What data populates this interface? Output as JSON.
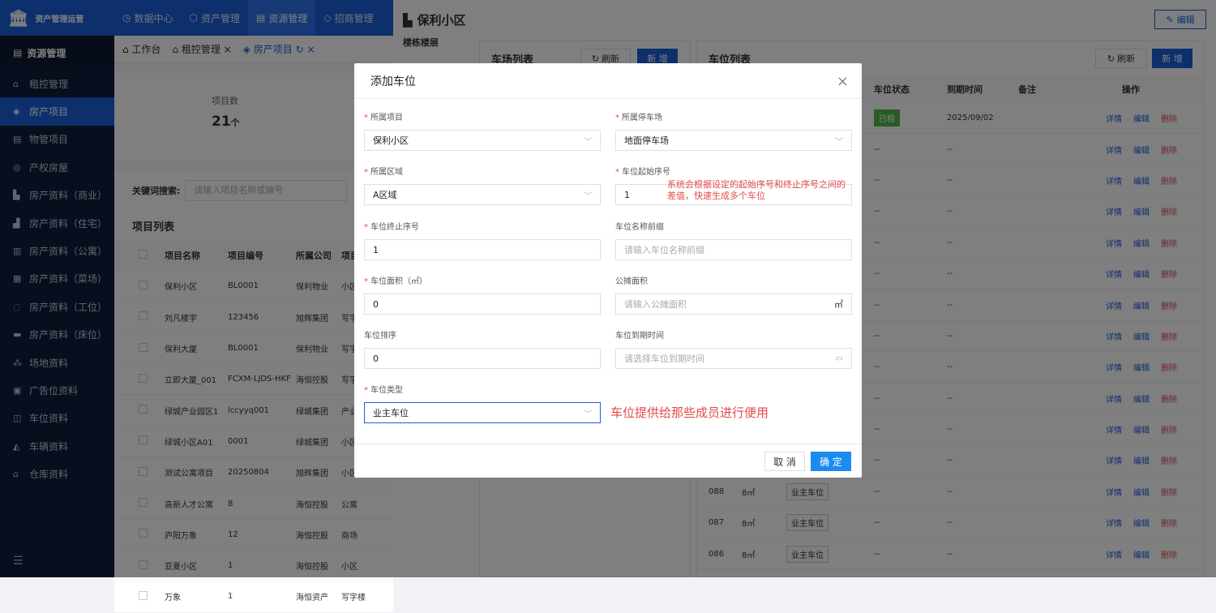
{
  "app": {
    "title": "资产管理运营"
  },
  "topnav": [
    {
      "icon": "◷",
      "label": "数据中心"
    },
    {
      "icon": "⬡",
      "label": "资产管理"
    },
    {
      "icon": "▤",
      "label": "资源管理"
    },
    {
      "icon": "◇",
      "label": "招商管理"
    }
  ],
  "sidebar": {
    "header": "资源管理",
    "items": [
      {
        "icon": "⌂",
        "label": "租控管理"
      },
      {
        "icon": "◈",
        "label": "房产项目"
      },
      {
        "icon": "▤",
        "label": "物管项目"
      },
      {
        "icon": "◎",
        "label": "产权房屋"
      },
      {
        "icon": "▙",
        "label": "房产资料（商业）"
      },
      {
        "icon": "▟",
        "label": "房产资料（住宅）"
      },
      {
        "icon": "▥",
        "label": "房产资料（公寓）"
      },
      {
        "icon": "▦",
        "label": "房产资料（菜场）"
      },
      {
        "icon": "◌",
        "label": "房产资料（工位）"
      },
      {
        "icon": "▬",
        "label": "房产资料（床位）"
      },
      {
        "icon": "⁂",
        "label": "场地资料"
      },
      {
        "icon": "▣",
        "label": "广告位资料"
      },
      {
        "icon": "◫",
        "label": "车位资料"
      },
      {
        "icon": "◭",
        "label": "车辆资料"
      },
      {
        "icon": "⌂",
        "label": "仓库资料"
      }
    ],
    "footer_icon": "☰"
  },
  "tabs": [
    {
      "label": "⌂ 工作台"
    },
    {
      "label": "⌂ 租控管理 ×"
    },
    {
      "label": "◈ 房产项目 ↻ ×"
    }
  ],
  "stat": {
    "label": "项目数",
    "value": "21",
    "unit": "个"
  },
  "search": {
    "label": "关键词搜索:",
    "placeholder": "请输入项目名称或编号"
  },
  "project_list": {
    "title": "项目列表",
    "headers": [
      "项目名称",
      "项目编号",
      "所属公司",
      "项目"
    ],
    "rows": [
      [
        "保利小区",
        "BL0001",
        "保利物业",
        "小区"
      ],
      [
        "刘凡楼宇",
        "123456",
        "旭辉集团",
        "写字"
      ],
      [
        "保利大厦",
        "BL0001",
        "保利物业",
        "写字"
      ],
      [
        "立即大厦_001",
        "FCXM-LJDS-HKF",
        "海恒控股",
        "写字"
      ],
      [
        "绿城产业园区1",
        "lccyyq001",
        "绿城集团",
        "产业"
      ],
      [
        "绿城小区A01",
        "0001",
        "绿城集团",
        "小区"
      ],
      [
        "测试公寓项目",
        "20250804",
        "旭辉集团",
        "小区"
      ],
      [
        "高新人才公寓",
        "8",
        "海恒控股",
        "公寓"
      ],
      [
        "庐阳万象",
        "12",
        "海恒控股",
        "商场"
      ],
      [
        "亚夏小区",
        "1",
        "海恒控股",
        "小区"
      ],
      [
        "万象",
        "1",
        "海恒资产",
        "写字楼"
      ]
    ]
  },
  "drawer": {
    "title": "保利小区",
    "edit_label": "编辑",
    "left_label": "楼栋楼层",
    "parking_lot": {
      "title": "车场列表",
      "refresh": "刷新",
      "add": "新 增"
    },
    "space_list": {
      "title": "车位列表",
      "refresh": "刷新",
      "add": "新 增",
      "headers": [
        "",
        "",
        "",
        "车位状态",
        "到期时间",
        "备注",
        "操作"
      ],
      "actions": [
        "详情",
        "编辑",
        "删除"
      ],
      "rows": [
        {
          "code": "",
          "area": "",
          "type": "",
          "status": "已租",
          "expire": "2025/09/02"
        },
        {
          "code": "",
          "area": "",
          "type": "",
          "status": "--",
          "expire": "--"
        },
        {
          "code": "",
          "area": "",
          "type": "",
          "status": "--",
          "expire": "--"
        },
        {
          "code": "",
          "area": "",
          "type": "",
          "status": "--",
          "expire": "--"
        },
        {
          "code": "",
          "area": "",
          "type": "",
          "status": "--",
          "expire": "--"
        },
        {
          "code": "",
          "area": "",
          "type": "",
          "status": "--",
          "expire": "--"
        },
        {
          "code": "",
          "area": "",
          "type": "",
          "status": "--",
          "expire": "--"
        },
        {
          "code": "",
          "area": "",
          "type": "",
          "status": "--",
          "expire": "--"
        },
        {
          "code": "",
          "area": "",
          "type": "",
          "status": "--",
          "expire": "--"
        },
        {
          "code": "",
          "area": "",
          "type": "",
          "status": "--",
          "expire": "--"
        },
        {
          "code": "",
          "area": "",
          "type": "",
          "status": "--",
          "expire": "--"
        },
        {
          "code": "",
          "area": "",
          "type": "",
          "status": "--",
          "expire": "--"
        },
        {
          "code": "088",
          "area": "8㎡",
          "type": "业主车位",
          "status": "--",
          "expire": "--"
        },
        {
          "code": "087",
          "area": "8㎡",
          "type": "业主车位",
          "status": "--",
          "expire": "--"
        },
        {
          "code": "086",
          "area": "8㎡",
          "type": "业主车位",
          "status": "--",
          "expire": "--"
        }
      ]
    }
  },
  "modal": {
    "title": "添加车位",
    "fields": {
      "project": {
        "label": "所属项目",
        "value": "保利小区"
      },
      "lot": {
        "label": "所属停车场",
        "value": "地面停车场"
      },
      "zone": {
        "label": "所属区域",
        "value": "A区域"
      },
      "start_no": {
        "label": "车位起始序号",
        "value": "1"
      },
      "end_no": {
        "label": "车位终止序号",
        "value": "1"
      },
      "prefix": {
        "label": "车位名称前缀",
        "placeholder": "请输入车位名称前缀"
      },
      "area": {
        "label": "车位面积（㎡）",
        "value": "0"
      },
      "shared": {
        "label": "公摊面积",
        "placeholder": "请输入公摊面积",
        "unit": "㎡"
      },
      "sort": {
        "label": "车位排序",
        "value": "0"
      },
      "expire": {
        "label": "车位到期时间",
        "placeholder": "请选择车位到期时间"
      },
      "type": {
        "label": "车位类型",
        "value": "业主车位"
      }
    },
    "note_sequence": "系统会根据设定的起始序号和终止序号之间的差值，快速生成多个车位",
    "note_type": "车位提供给那些成员进行便用",
    "cancel": "取 消",
    "confirm": "确 定"
  }
}
